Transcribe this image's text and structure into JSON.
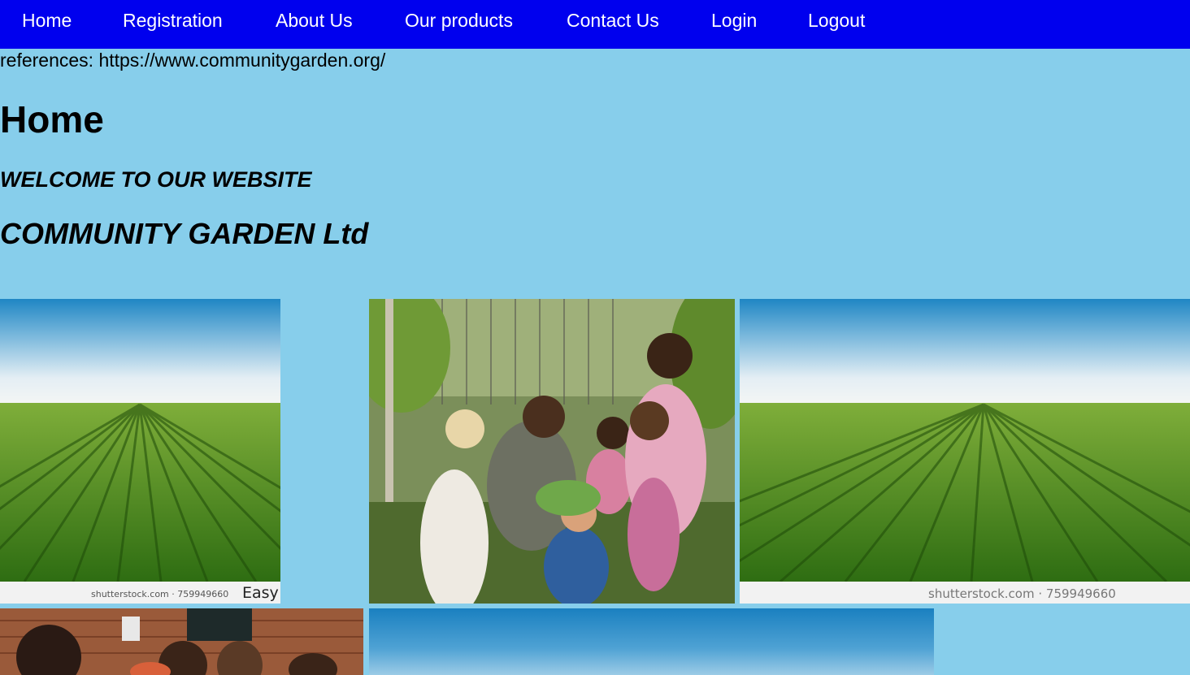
{
  "nav": {
    "items": [
      {
        "label": "Home"
      },
      {
        "label": "Registration"
      },
      {
        "label": "About Us"
      },
      {
        "label": "Our products"
      },
      {
        "label": "Contact Us"
      },
      {
        "label": "Login"
      },
      {
        "label": "Logout"
      }
    ]
  },
  "references": "references: https://www.communitygarden.org/",
  "page_title": "Home",
  "welcome": "WELCOME TO OUR WEBSITE",
  "company": "COMMUNITY GARDEN Ltd",
  "images": {
    "field_1_watermark": "shutterstock.com · 759949660",
    "field_1_badge": "Easy",
    "field_2_watermark": "shutterstock.com · 759949660"
  },
  "colors": {
    "nav_background": "#0000ee",
    "page_background": "#87ceeb",
    "nav_text": "#ffffff"
  }
}
